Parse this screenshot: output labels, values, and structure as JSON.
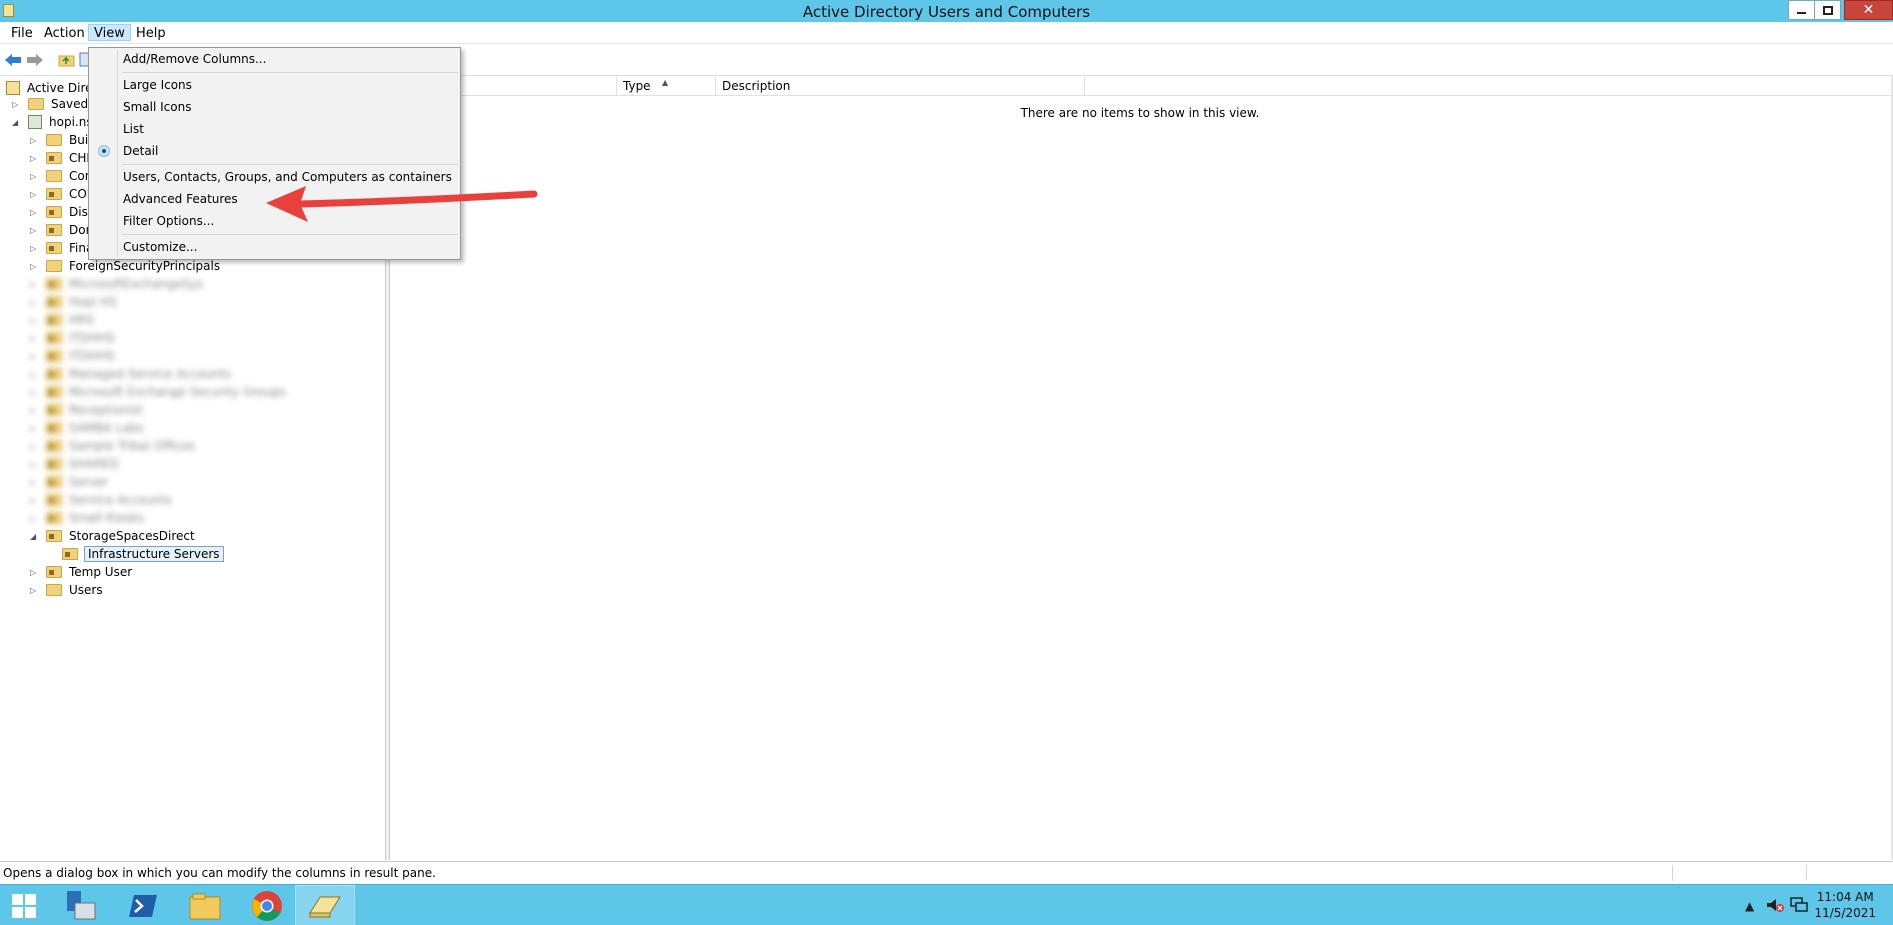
{
  "window": {
    "title": "Active Directory Users and Computers"
  },
  "menubar": {
    "items": [
      "File",
      "Action",
      "View",
      "Help"
    ]
  },
  "view_menu": {
    "items": [
      {
        "label": "Add/Remove Columns..."
      },
      {
        "label": "Large Icons"
      },
      {
        "label": "Small Icons"
      },
      {
        "label": "List"
      },
      {
        "label": "Detail",
        "checked": true
      },
      {
        "label": "Users, Contacts, Groups, and Computers as containers"
      },
      {
        "label": "Advanced Features"
      },
      {
        "label": "Filter Options..."
      },
      {
        "label": "Customize..."
      }
    ]
  },
  "tree": {
    "root": "Active Direc",
    "saved_queries": "Saved Q",
    "domain": "hopi.nsr",
    "children": [
      "Built",
      "CHR",
      "Com",
      "COU",
      "Disa",
      "Dom",
      "Fina",
      "ForeignSecurityPrincipals"
    ],
    "blurred_items": [
      "MicrosoftExchangeSys",
      "Hopi HS",
      "HRS",
      "ITDHHS",
      "ITDHHS",
      "Managed Service Accounts",
      "Microsoft Exchange Security Groups",
      "Receptionist",
      "SAMBA Labs",
      "Sample Tribal Offices",
      "SHARED",
      "Server",
      "Service Accounts",
      "Small Kiosks"
    ],
    "storage": "StorageSpacesDirect",
    "storage_child": "Infrastructure Servers",
    "after": [
      "Temp User",
      "Users"
    ]
  },
  "list": {
    "columns": [
      "Type",
      "Description"
    ],
    "empty_message": "There are no items to show in this view."
  },
  "status": {
    "text": "Opens a dialog box in which you can modify the columns in result pane."
  },
  "tray": {
    "time": "11:04 AM",
    "date": "11/5/2021"
  },
  "colors": {
    "titlebar": "#5ec7e9",
    "taskbar": "#5ec7e9",
    "annotation_arrow": "#e8413c",
    "menu_highlight": "#cce8ff"
  }
}
